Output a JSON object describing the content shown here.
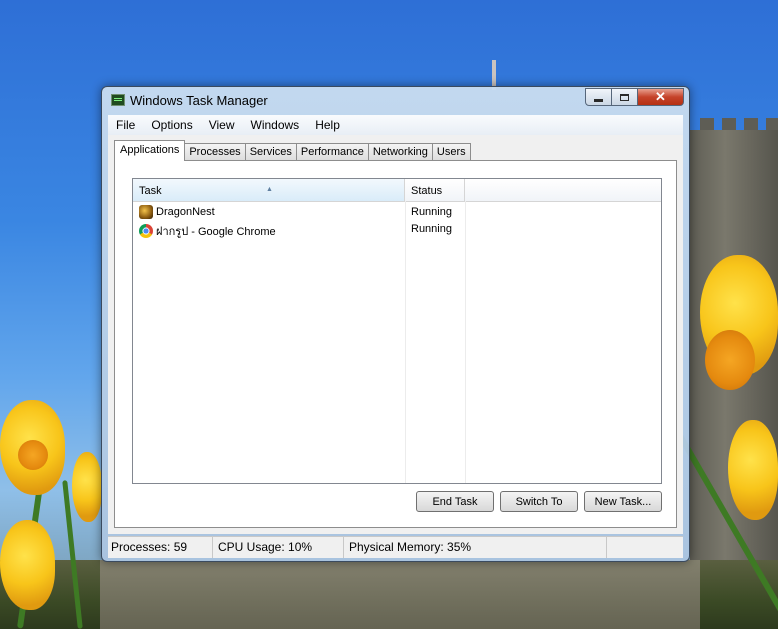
{
  "window": {
    "title": "Windows Task Manager"
  },
  "menu": [
    "File",
    "Options",
    "View",
    "Windows",
    "Help"
  ],
  "tabs": [
    "Applications",
    "Processes",
    "Services",
    "Performance",
    "Networking",
    "Users"
  ],
  "active_tab": "Applications",
  "columns": {
    "task": "Task",
    "status": "Status"
  },
  "applications": [
    {
      "name": "DragonNest",
      "status": "Running",
      "icon": "dragonnest-icon"
    },
    {
      "name": "ฝากรูป - Google Chrome",
      "status": "Running",
      "icon": "chrome-icon"
    }
  ],
  "buttons": {
    "end_task": "End Task",
    "switch_to": "Switch To",
    "new_task": "New Task..."
  },
  "statusbar": {
    "processes": "Processes: 59",
    "cpu": "CPU Usage: 10%",
    "memory": "Physical Memory: 35%"
  },
  "colors": {
    "close_button": "#c5432a",
    "header_selected": "#d9ecf9",
    "sky": "#3a86e2"
  }
}
